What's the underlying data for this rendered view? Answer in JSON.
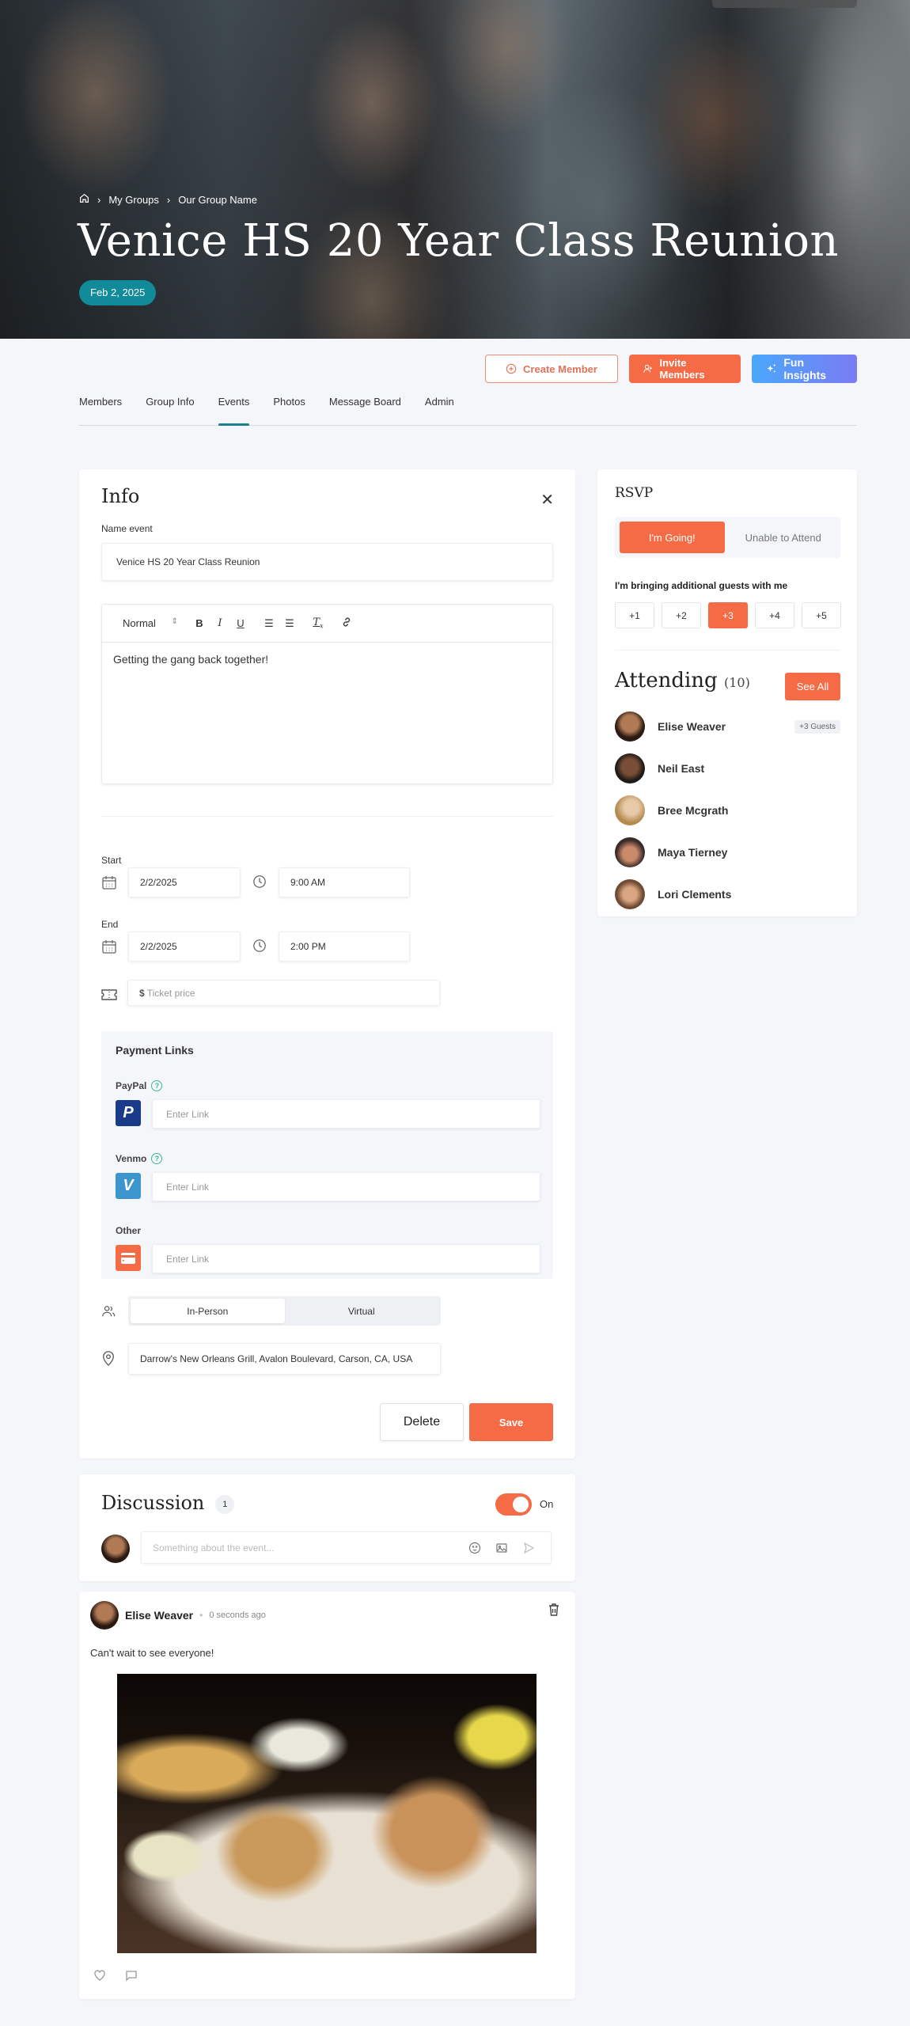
{
  "hero": {
    "breadcrumb": {
      "home_icon": "home-icon",
      "items": [
        "My Groups",
        "Our Group Name"
      ]
    },
    "title": "Venice HS 20 Year Class Reunion",
    "date": "Feb 2, 2025"
  },
  "actions": {
    "create_member": "Create Member",
    "invite_members": "Invite Members",
    "fun_insights": "Fun Insights"
  },
  "tabs": [
    {
      "label": "Members",
      "active": false
    },
    {
      "label": "Group Info",
      "active": false
    },
    {
      "label": "Events",
      "active": true
    },
    {
      "label": "Photos",
      "active": false
    },
    {
      "label": "Message Board",
      "active": false
    },
    {
      "label": "Admin",
      "active": false
    }
  ],
  "info": {
    "title": "Info",
    "name_label": "Name event",
    "name_value": "Venice HS 20 Year Class Reunion",
    "editor": {
      "format": "Normal",
      "tools": [
        "bold",
        "italic",
        "underline",
        "ordered-list",
        "bullet-list",
        "clear-format",
        "link"
      ],
      "body": "Getting the gang back together!"
    },
    "start": {
      "label": "Start",
      "date": "2/2/2025",
      "time": "9:00 AM"
    },
    "end": {
      "label": "End",
      "date": "2/2/2025",
      "time": "2:00 PM"
    },
    "ticket": {
      "prefix": "$",
      "placeholder": "Ticket price"
    },
    "payment": {
      "title": "Payment Links",
      "links": [
        {
          "label": "PayPal",
          "help": true,
          "logo": "P",
          "color": "#1a3a8a",
          "placeholder": "Enter Link"
        },
        {
          "label": "Venmo",
          "help": true,
          "logo": "V",
          "color": "#3d95ce",
          "placeholder": "Enter Link"
        },
        {
          "label": "Other",
          "help": false,
          "logo": "card",
          "color": "#f46b45",
          "placeholder": "Enter Link"
        }
      ]
    },
    "mode": {
      "options": [
        "In-Person",
        "Virtual"
      ],
      "selected": "In-Person"
    },
    "location": "Darrow's New Orleans Grill, Avalon Boulevard, Carson, CA, USA",
    "delete_label": "Delete",
    "save_label": "Save"
  },
  "rsvp": {
    "title": "RSVP",
    "going_label": "I'm Going!",
    "unable_label": "Unable to Attend",
    "selected": "going",
    "guests_label": "I'm bringing additional guests with me",
    "guest_options": [
      "+1",
      "+2",
      "+3",
      "+4",
      "+5"
    ],
    "guest_selected": "+3",
    "attending_title": "Attending",
    "attending_count": "(10)",
    "see_all": "See All",
    "attendees": [
      {
        "name": "Elise Weaver",
        "badge": "+3 Guests",
        "avatar_color": "#5a3a28"
      },
      {
        "name": "Neil East",
        "badge": "",
        "avatar_color": "#3b2a22"
      },
      {
        "name": "Bree Mcgrath",
        "badge": "",
        "avatar_color": "#c7a06a"
      },
      {
        "name": "Maya Tierney",
        "badge": "",
        "avatar_color": "#7a4a3a"
      },
      {
        "name": "Lori Clements",
        "badge": "",
        "avatar_color": "#b88060"
      }
    ]
  },
  "discussion": {
    "title": "Discussion",
    "count": "1",
    "toggle_on": true,
    "toggle_label": "On",
    "input_placeholder": "Something about the event..."
  },
  "post": {
    "author": "Elise Weaver",
    "time": "0 seconds ago",
    "text": "Can't wait to see everyone!",
    "image_alt": "Crab cakes with fries, coleslaw and tartar sauce"
  },
  "colors": {
    "accent": "#f46b45",
    "teal": "#118a9a",
    "tab_indicator": "#1b7f8a",
    "help": "#3ab795"
  }
}
